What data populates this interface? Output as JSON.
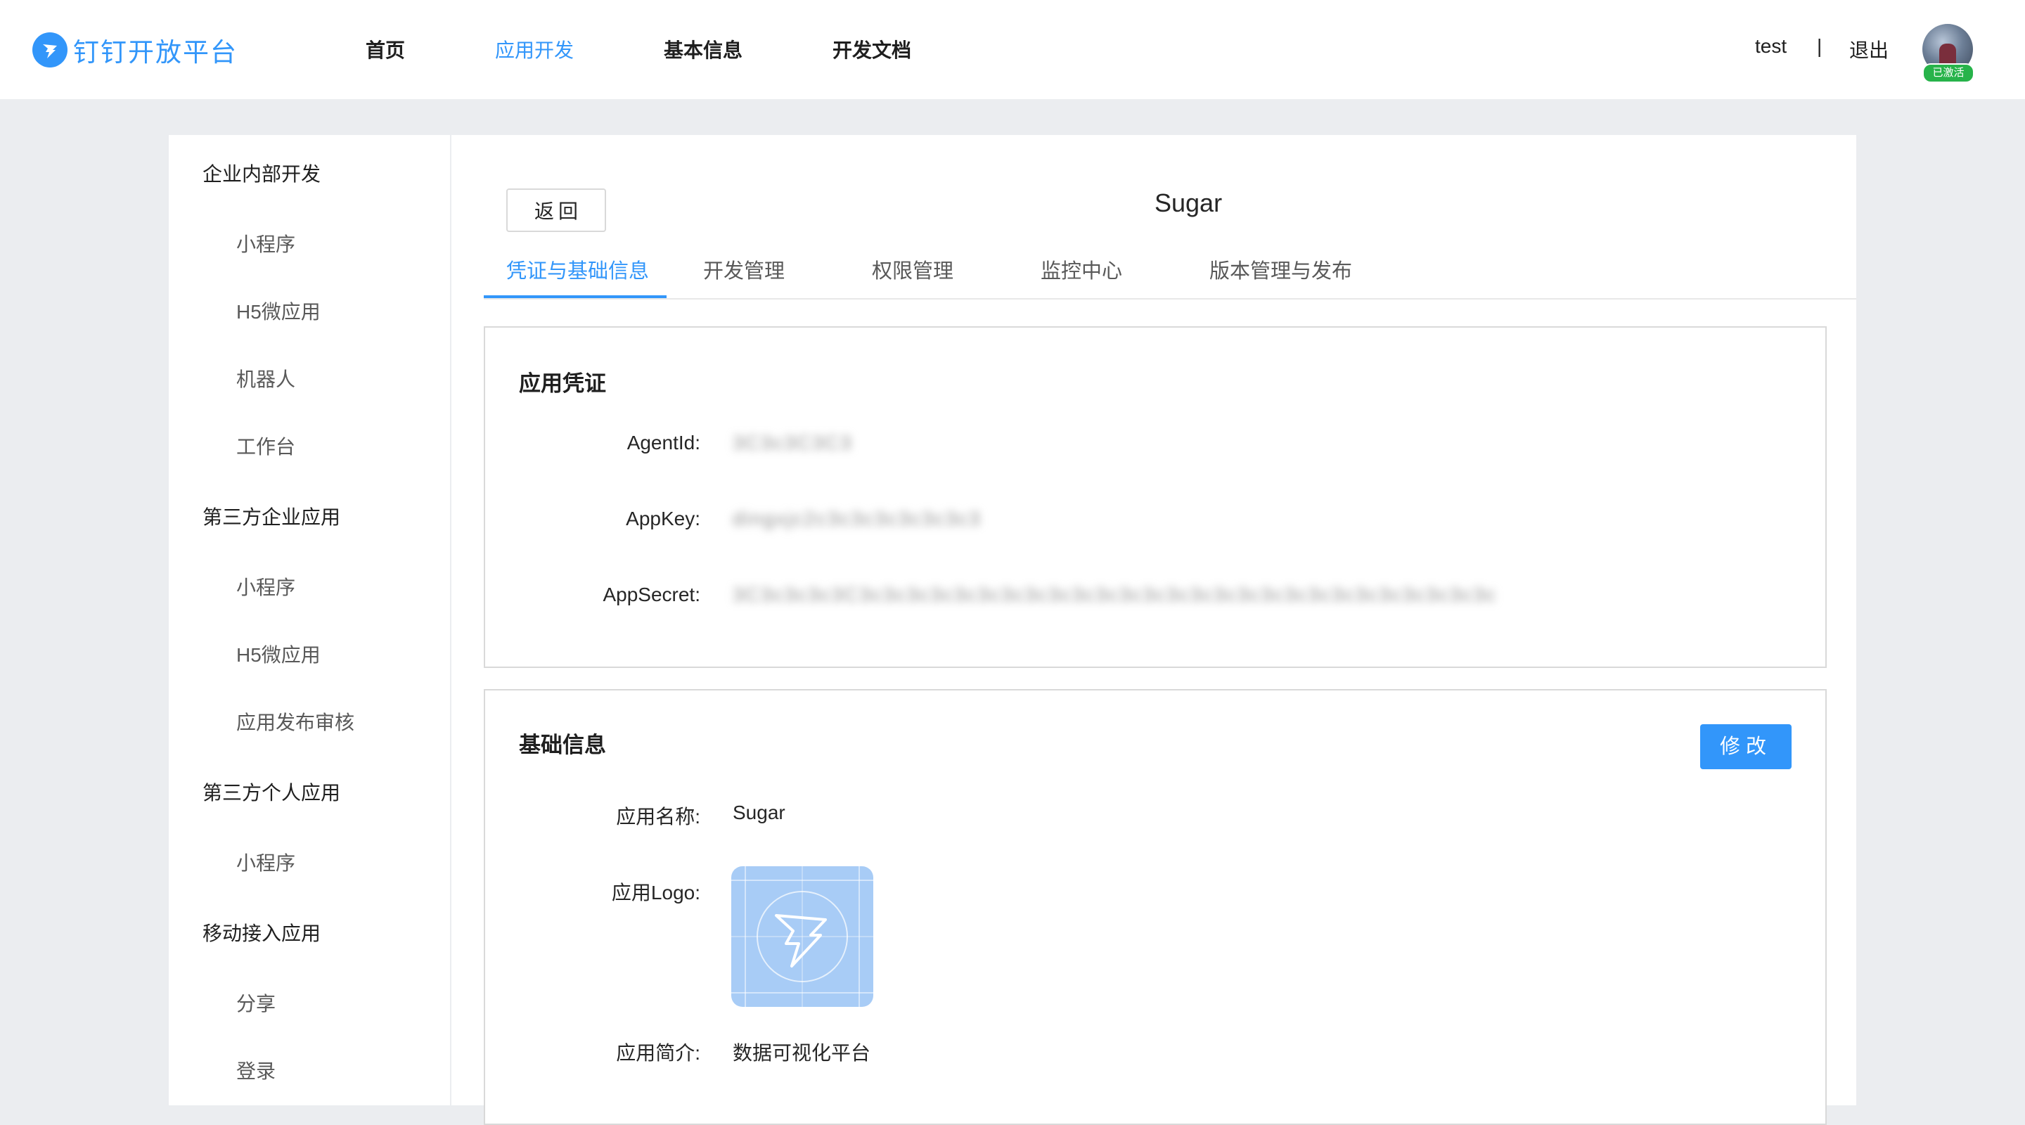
{
  "brand": {
    "name": "钉钉开放平台",
    "color": "#3296fa"
  },
  "nav": [
    {
      "label": "首页"
    },
    {
      "label": "应用开发"
    },
    {
      "label": "基本信息"
    },
    {
      "label": "开发文档"
    }
  ],
  "user": {
    "name": "test",
    "separator": "|",
    "logout": "退出",
    "status_badge": "已激活"
  },
  "sidebar": {
    "groups": [
      {
        "title": "企业内部开发",
        "items": [
          "小程序",
          "H5微应用",
          "机器人",
          "工作台"
        ]
      },
      {
        "title": "第三方企业应用",
        "items": [
          "小程序",
          "H5微应用",
          "应用发布审核"
        ]
      },
      {
        "title": "第三方个人应用",
        "items": [
          "小程序"
        ]
      },
      {
        "title": "移动接入应用",
        "items": [
          "分享",
          "登录"
        ]
      }
    ]
  },
  "main": {
    "back_label": "返回",
    "app_title": "Sugar",
    "tabs": [
      "凭证与基础信息",
      "开发管理",
      "权限管理",
      "监控中心",
      "版本管理与发布"
    ],
    "credentials": {
      "title": "应用凭证",
      "fields": [
        {
          "label": "AgentId:",
          "value": "3C3c3C3C3"
        },
        {
          "label": "AppKey:",
          "value": "dingxjc2c3c3c3c3c3c3c3"
        },
        {
          "label": "AppSecret:",
          "value": "3C3c3c3c3C3c3c3c3c3c3c3c3c3c3c3c3c3c3c3c3c3c3c3c3c3c3c3c3c3c3c3c"
        }
      ]
    },
    "basic_info": {
      "title": "基础信息",
      "edit_label": "修改",
      "fields": [
        {
          "label": "应用名称:",
          "value": "Sugar"
        },
        {
          "label": "应用Logo:",
          "value": ""
        },
        {
          "label": "应用简介:",
          "value": "数据可视化平台"
        }
      ]
    }
  }
}
